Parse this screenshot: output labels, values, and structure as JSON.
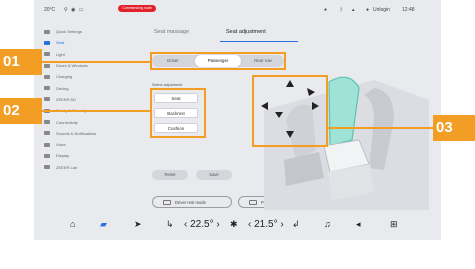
{
  "status": {
    "temp_outside": "20°C",
    "recording": "Commencing route",
    "user": "Unlogin",
    "time": "12:48"
  },
  "sidebar": {
    "items": [
      {
        "label": "Quick Settings",
        "icon": "quick-settings-icon",
        "active": false
      },
      {
        "label": "Seat",
        "icon": "seat-icon",
        "active": true
      },
      {
        "label": "Light",
        "icon": "light-icon",
        "active": false
      },
      {
        "label": "Doors & Windows",
        "icon": "door-icon",
        "active": false
      },
      {
        "label": "Charging",
        "icon": "charging-icon",
        "active": false
      },
      {
        "label": "Driving",
        "icon": "car-icon",
        "active": false
      },
      {
        "label": "ZEEKR AD",
        "icon": "ad-icon",
        "active": false
      },
      {
        "label": "Safety & Security",
        "icon": "shield-icon",
        "active": false
      },
      {
        "label": "Connectivity",
        "icon": "wifi-icon",
        "active": false
      },
      {
        "label": "Sounds & Notifications",
        "icon": "sound-icon",
        "active": false
      },
      {
        "label": "Voice",
        "icon": "voice-icon",
        "active": false
      },
      {
        "label": "Display",
        "icon": "display-icon",
        "active": false
      },
      {
        "label": "ZEEKR Lab",
        "icon": "lab-icon",
        "active": false
      }
    ]
  },
  "tabs": [
    {
      "label": "Seat massage",
      "active": false
    },
    {
      "label": "Seat adjustment",
      "active": true
    }
  ],
  "seat_selector": {
    "options": [
      "Driver",
      "Passenger",
      "Rear row"
    ],
    "selected": "Passenger"
  },
  "adjustment": {
    "label": "Select adjustment",
    "options": [
      "Seat",
      "Backrest",
      "Cushion"
    ],
    "selected": "Seat"
  },
  "actions": {
    "reset": "Reset",
    "save": "Save"
  },
  "modes": {
    "driver": "Driver rest mode",
    "passenger": "Passenger rest mode"
  },
  "bottom": {
    "temp_left": "22.5",
    "temp_right": "21.5"
  },
  "callouts": [
    "01",
    "02",
    "03"
  ],
  "colors": {
    "accent": "#2a6fe0",
    "callout": "#f29d23",
    "seat_highlight": "#9fe3d6"
  }
}
